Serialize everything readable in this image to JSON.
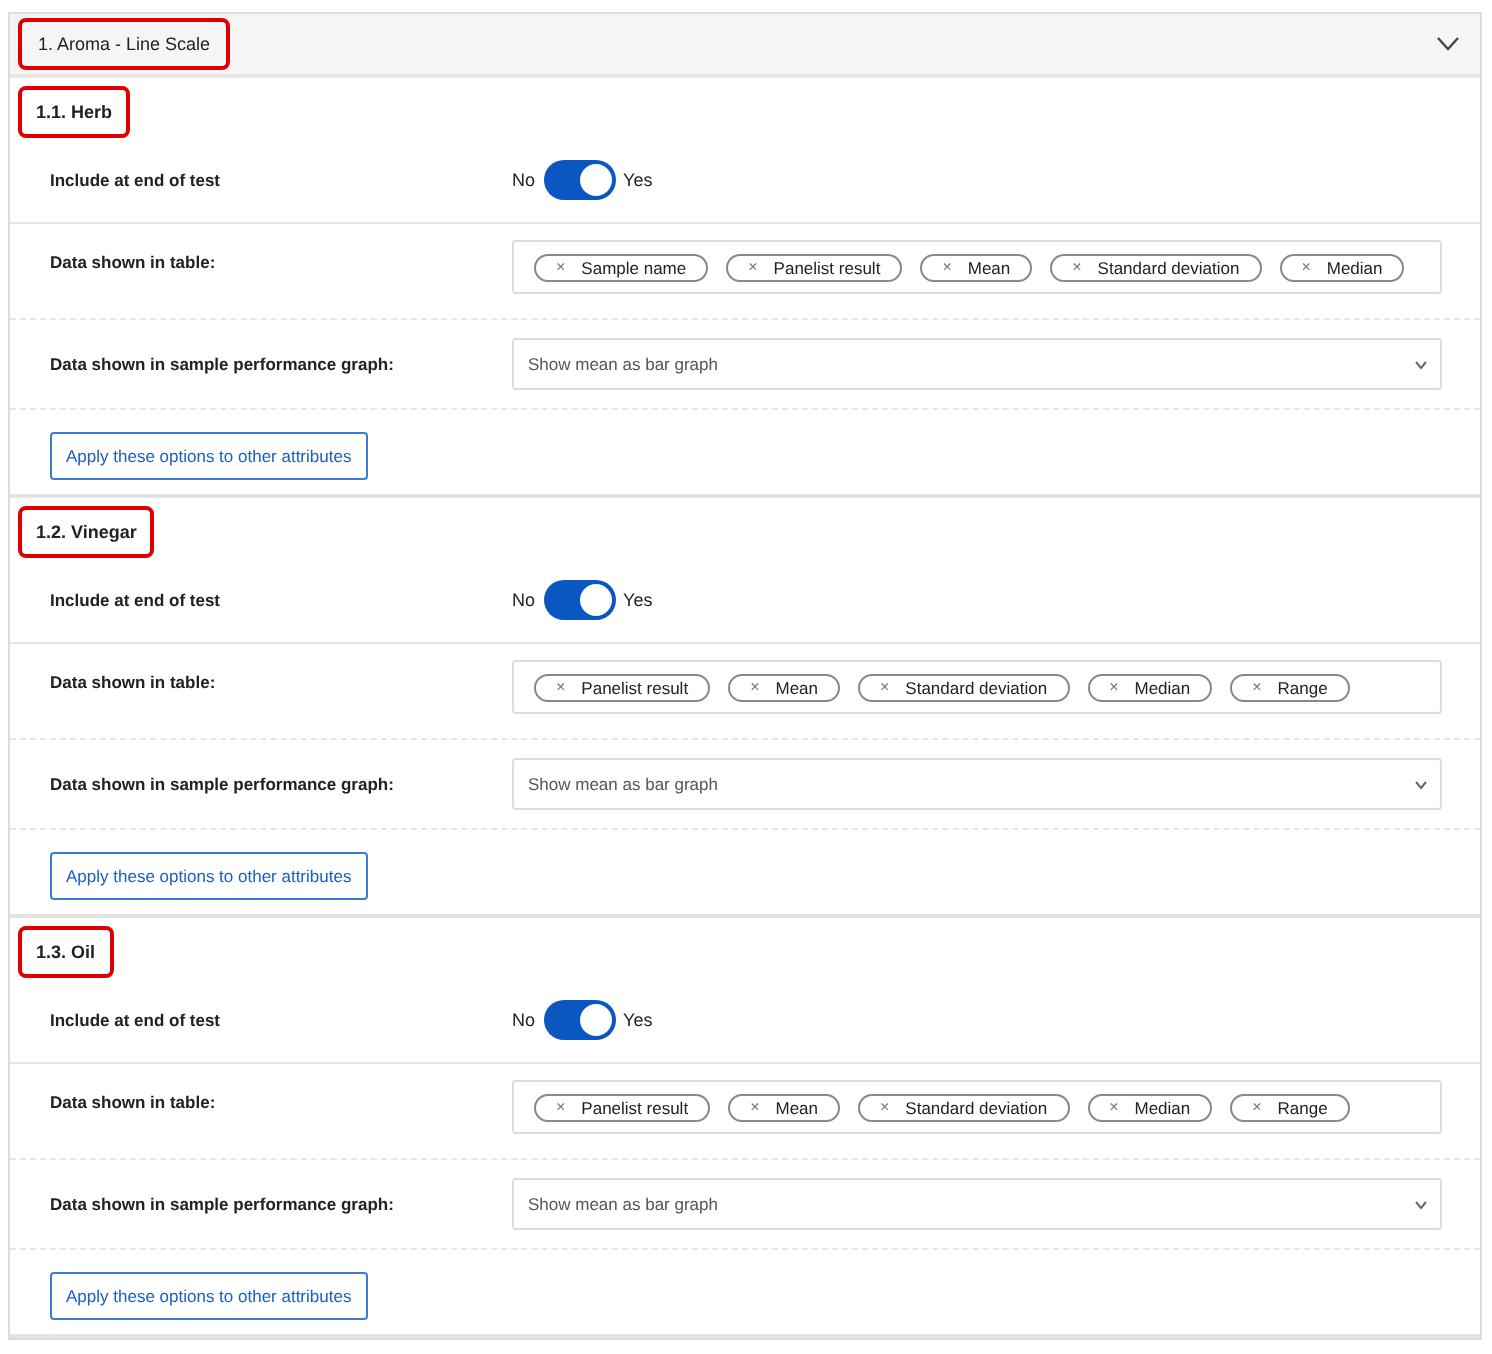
{
  "header": {
    "title": "1. Aroma - Line Scale",
    "highlighted": true,
    "expanded": true
  },
  "sections": [
    {
      "title": "1.1. Herb",
      "highlighted": true,
      "include": {
        "label": "Include at end of test",
        "off_label": "No",
        "on_label": "Yes",
        "on": true
      },
      "table": {
        "label": "Data shown in table:",
        "tags": [
          {
            "remove": "×",
            "label": "Sample name"
          },
          {
            "remove": "×",
            "label": "Panelist result"
          },
          {
            "remove": "×",
            "label": "Mean"
          },
          {
            "remove": "×",
            "label": "Standard deviation"
          },
          {
            "remove": "×",
            "label": "Median"
          }
        ]
      },
      "graph": {
        "label": "Data shown in sample performance graph:",
        "value": "Show mean as bar graph"
      },
      "button": "Apply these options to other attributes"
    },
    {
      "title": "1.2. Vinegar",
      "highlighted": true,
      "include": {
        "label": "Include at end of test",
        "off_label": "No",
        "on_label": "Yes",
        "on": true
      },
      "table": {
        "label": "Data shown in table:",
        "tags": [
          {
            "remove": "×",
            "label": "Panelist result"
          },
          {
            "remove": "×",
            "label": "Mean"
          },
          {
            "remove": "×",
            "label": "Standard deviation"
          },
          {
            "remove": "×",
            "label": "Median"
          },
          {
            "remove": "×",
            "label": "Range"
          }
        ]
      },
      "graph": {
        "label": "Data shown in sample performance graph:",
        "value": "Show mean as bar graph"
      },
      "button": "Apply these options to other attributes"
    },
    {
      "title": "1.3. Oil",
      "highlighted": true,
      "include": {
        "label": "Include at end of test",
        "off_label": "No",
        "on_label": "Yes",
        "on": true
      },
      "table": {
        "label": "Data shown in table:",
        "tags": [
          {
            "remove": "×",
            "label": "Panelist result"
          },
          {
            "remove": "×",
            "label": "Mean"
          },
          {
            "remove": "×",
            "label": "Standard deviation"
          },
          {
            "remove": "×",
            "label": "Median"
          },
          {
            "remove": "×",
            "label": "Range"
          }
        ]
      },
      "graph": {
        "label": "Data shown in sample performance graph:",
        "value": "Show mean as bar graph"
      },
      "button": "Apply these options to other attributes"
    }
  ]
}
